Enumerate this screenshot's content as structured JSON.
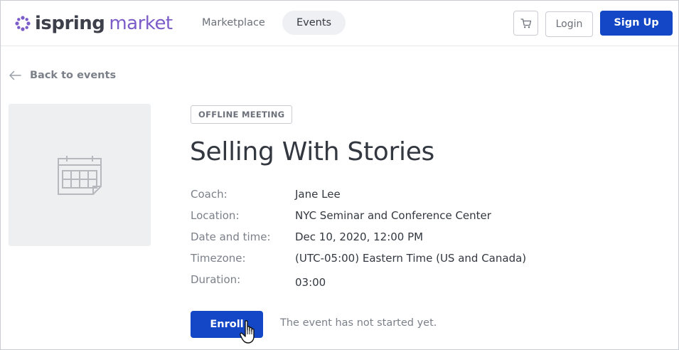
{
  "header": {
    "logo_brand": "ispring",
    "logo_product": "market",
    "nav": [
      {
        "label": "Marketplace"
      },
      {
        "label": "Events"
      }
    ],
    "cart_icon": "cart-icon",
    "login_label": "Login",
    "signup_label": "Sign Up"
  },
  "back": {
    "icon": "arrow-left-icon",
    "label": "Back to events"
  },
  "event": {
    "thumbnail_icon": "calendar-icon",
    "badge": "OFFLINE MEETING",
    "title": "Selling With Stories",
    "details": [
      {
        "label": "Coach:",
        "value": "Jane Lee"
      },
      {
        "label": "Location:",
        "value": "NYC Seminar and Conference Center"
      },
      {
        "label": "Date and time:",
        "value": "Dec 10, 2020, 12:00 PM"
      },
      {
        "label": "Timezone:",
        "value": "(UTC-05:00) Eastern Time (US and Canada)"
      },
      {
        "label": "Duration:",
        "value": "03:00"
      }
    ],
    "enroll_label": "Enroll",
    "status_text": "The event has not started yet."
  },
  "colors": {
    "primary": "#1347c5",
    "brand_purple": "#7b5cc9",
    "text_dark": "#333840",
    "text_muted": "#7b8089",
    "thumb_bg": "#eeeff1"
  }
}
